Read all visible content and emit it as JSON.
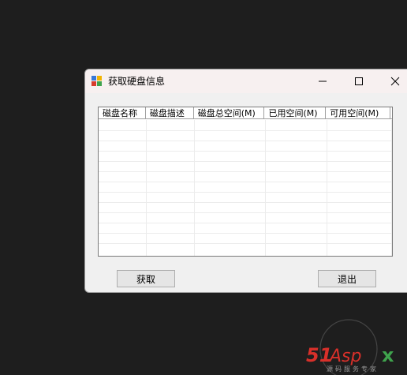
{
  "window": {
    "title": "获取硬盘信息"
  },
  "listview": {
    "columns": [
      "磁盘名称",
      "磁盘描述",
      "磁盘总空间(M)",
      "已用空间(M)",
      "可用空间(M)"
    ],
    "rows": []
  },
  "buttons": {
    "get_label": "获取",
    "exit_label": "退出"
  },
  "watermark": {
    "logo_text": "51Aspx",
    "slogan": "源码服务专家"
  }
}
